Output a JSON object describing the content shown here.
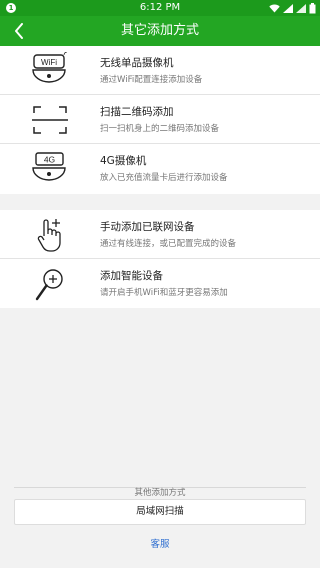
{
  "status_bar": {
    "notification_badge": "1",
    "time": "6:12 PM",
    "icons": [
      "wifi-icon",
      "signal-icon",
      "signal-icon",
      "battery-icon"
    ]
  },
  "header": {
    "back_icon": "chevron-left-icon",
    "title": "其它添加方式"
  },
  "options_group_1": [
    {
      "icon": "wifi-camera-icon",
      "icon_text": "WiFi",
      "label": "无线单品摄像机",
      "desc": "通过WiFi配置连接添加设备"
    },
    {
      "icon": "scan-frame-icon",
      "label": "扫描二维码添加",
      "desc": "扫一扫机身上的二维码添加设备"
    },
    {
      "icon": "4g-camera-icon",
      "icon_text": "4G",
      "label": "4G摄像机",
      "desc": "放入已充值流量卡后进行添加设备"
    }
  ],
  "options_group_2": [
    {
      "icon": "hand-pointer-plus-icon",
      "label": "手动添加已联网设备",
      "desc": "通过有线连接，或已配置完成的设备"
    },
    {
      "icon": "magnifier-plus-icon",
      "label": "添加智能设备",
      "desc": "请开启手机WiFi和蓝牙更容易添加"
    }
  ],
  "footer": {
    "other_methods_label": "其他添加方式",
    "lan_scan_button": "局域网扫描",
    "customer_service_link": "客服"
  },
  "colors": {
    "status_bar": "#1c9a1c",
    "title_bar": "#23a623",
    "link": "#2f6fd0"
  }
}
